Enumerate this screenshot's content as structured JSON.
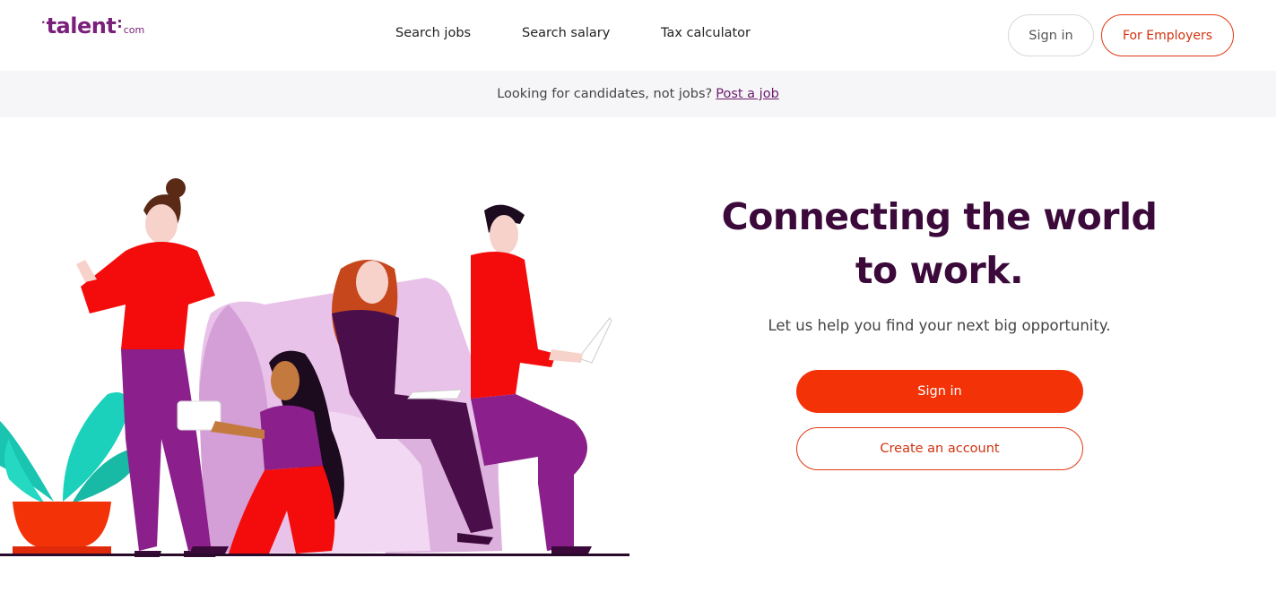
{
  "header": {
    "logo": {
      "dot": "·",
      "word": "talent",
      "colon": ":",
      "suffix": "com"
    },
    "nav": [
      "Search jobs",
      "Search salary",
      "Tax calculator"
    ],
    "sign_in_label": "Sign in",
    "employers_label": "For Employers"
  },
  "banner": {
    "text": "Looking for candidates, not jobs?",
    "link": "Post a job"
  },
  "hero": {
    "headline_line1": "Connecting the world",
    "headline_line2": "to work.",
    "subtitle": "Let us help you find your next big opportunity.",
    "sign_in_label": "Sign in",
    "create_account_label": "Create an account"
  },
  "colors": {
    "brand_purple": "#7a1f7a",
    "headline": "#3b0a3b",
    "accent_orange": "#f43208",
    "banner_bg": "#f6f6f8"
  }
}
